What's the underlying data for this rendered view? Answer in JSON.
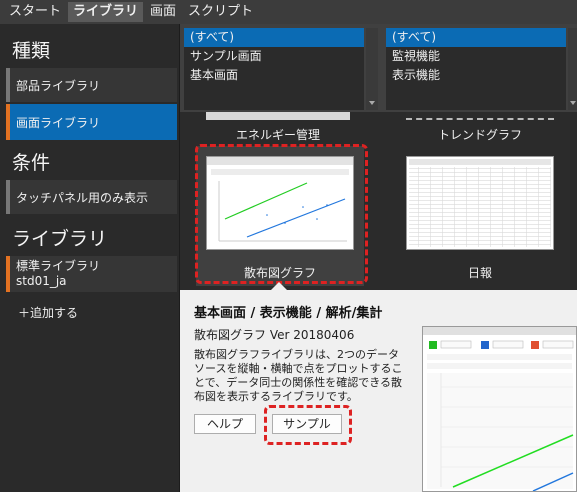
{
  "menubar": {
    "tabs": [
      "スタート",
      "ライブラリ",
      "画面",
      "スクリプト"
    ]
  },
  "sidebar": {
    "category_header": "種類",
    "category_items": [
      "部品ライブラリ",
      "画面ライブラリ"
    ],
    "condition_header": "条件",
    "condition_items": [
      "タッチパネル用のみ表示"
    ],
    "library_header": "ライブラリ",
    "library_name": "標準ライブラリ",
    "library_id": "std01_ja",
    "add_label": "＋追加する"
  },
  "filters": {
    "list1": [
      "(すべて)",
      "サンプル画面",
      "基本画面"
    ],
    "list2": [
      "(すべて)",
      "監視機能",
      "表示機能"
    ]
  },
  "gallery": {
    "top_cards": [
      "エネルギー管理",
      "トレンドグラフ"
    ],
    "cards": [
      "散布図グラフ",
      "日報"
    ]
  },
  "detail": {
    "path": "基本画面 / 表示機能 / 解析/集計",
    "name": "散布図グラフ",
    "version": "Ver 20180406",
    "description": "散布図グラフライブラリは、2つのデータソースを縦軸・横軸で点をプロットすることで、データ同士の関係性を確認できる散布図を表示するライブラリです。",
    "help_button": "ヘルプ",
    "sample_button": "サンプル"
  },
  "colors": {
    "selection": "#0b6bb4",
    "accent": "#e37222",
    "highlight_dash": "#dd2222"
  }
}
